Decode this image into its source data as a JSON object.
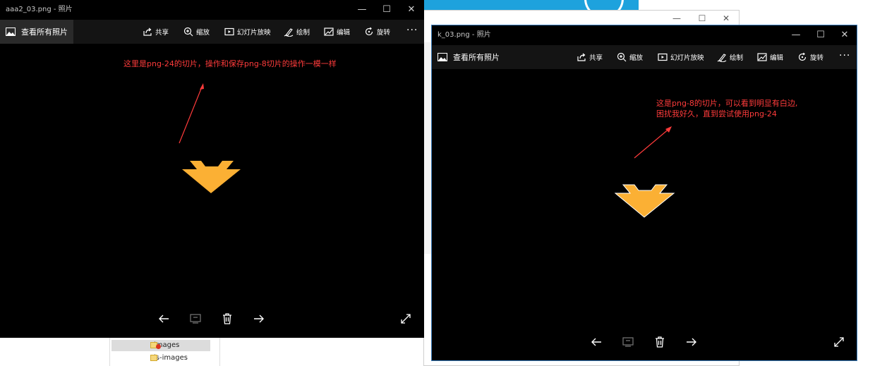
{
  "window_left": {
    "title": "aaa2_03.png - 照片",
    "view_all_label": "查看所有照片",
    "tools": [
      {
        "label": "共享",
        "icon": "share-icon"
      },
      {
        "label": "缩放",
        "icon": "zoom-icon"
      },
      {
        "label": "幻灯片放映",
        "icon": "slideshow-icon"
      },
      {
        "label": "绘制",
        "icon": "draw-icon"
      },
      {
        "label": "编辑",
        "icon": "edit-icon"
      },
      {
        "label": "旋转",
        "icon": "rotate-icon"
      }
    ],
    "more_label": "···",
    "annotation": "这里是png-24的切片，操作和保存png-8切片的操作一模一样",
    "shape_color": "#fbb034"
  },
  "window_right": {
    "title": "k_03.png - 照片",
    "view_all_label": "查看所有照片",
    "tools": [
      {
        "label": "共享",
        "icon": "share-icon"
      },
      {
        "label": "缩放",
        "icon": "zoom-icon"
      },
      {
        "label": "幻灯片放映",
        "icon": "slideshow-icon"
      },
      {
        "label": "绘制",
        "icon": "draw-icon"
      },
      {
        "label": "编辑",
        "icon": "edit-icon"
      },
      {
        "label": "旋转",
        "icon": "rotate-icon"
      }
    ],
    "more_label": "···",
    "annotation_line1": "这是png-8的切片，可以看到明显有白边,",
    "annotation_line2": "困扰我好久，直到尝试使用png-24",
    "shape_color": "#fbb034"
  },
  "window_controls": {
    "minimize": "—",
    "maximize": "☐",
    "close": "✕"
  },
  "explorer": {
    "items": [
      {
        "label": "images",
        "selected": true
      },
      {
        "label": "js-images",
        "selected": false
      }
    ]
  },
  "colors": {
    "annotation": "#ff3b3b",
    "window_bg": "#000000",
    "toolbar_bg": "#141414",
    "accent_border": "#3c7fbf"
  }
}
